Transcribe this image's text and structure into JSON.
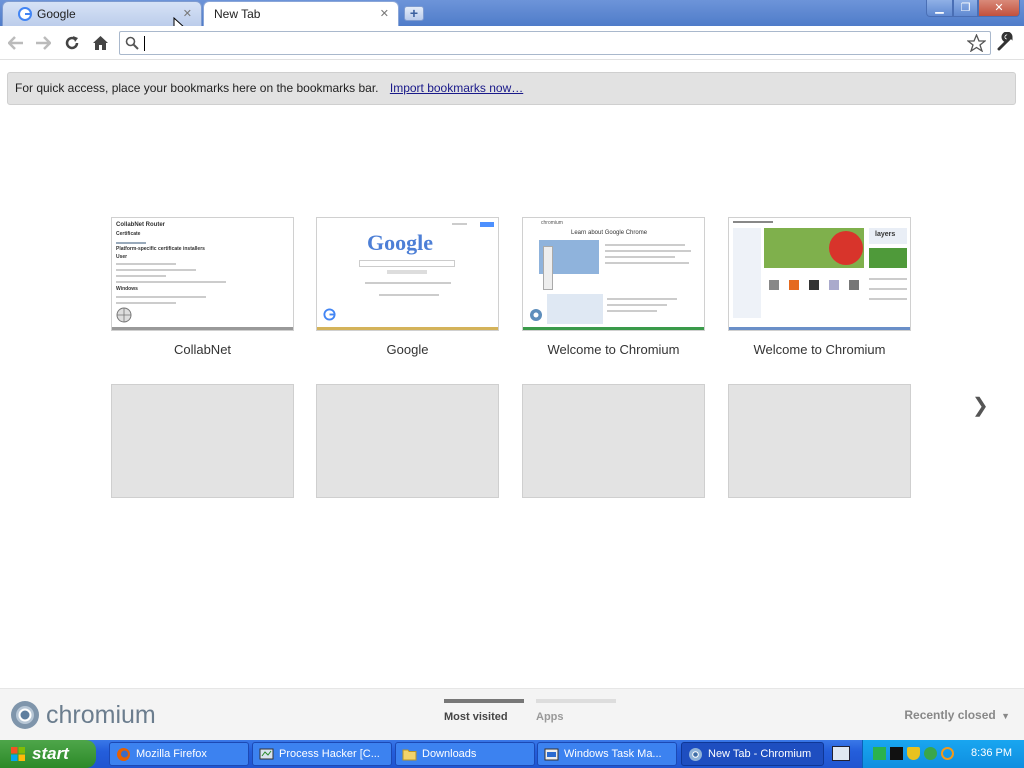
{
  "tabs": [
    {
      "label": "Google",
      "active": false
    },
    {
      "label": "New Tab",
      "active": true
    }
  ],
  "toolbar": {
    "omnibox_value": ""
  },
  "bookmark_prompt": {
    "text": "For quick access, place your bookmarks here on the bookmarks bar.",
    "link": "Import bookmarks now…"
  },
  "most_visited": [
    {
      "title": "CollabNet",
      "stripe": "#999999"
    },
    {
      "title": "Google",
      "stripe": "#d4b35a"
    },
    {
      "title": "Welcome to Chromium",
      "stripe": "#3a9a4a"
    },
    {
      "title": "Welcome to Chromium",
      "stripe": "#6a8fc8"
    }
  ],
  "thumb_text": {
    "collabnet_title": "CollabNet Router",
    "collabnet_l1": "Certificate",
    "collabnet_l2": "Platform-specific certificate installers",
    "collabnet_l3": "User",
    "collabnet_l4": "Windows",
    "google_logo": "Google",
    "chromium_heading": "Learn about Google Chrome",
    "chromium_word": "chromium",
    "layers": "layers"
  },
  "footer": {
    "brand": "chromium",
    "tab_most_visited": "Most visited",
    "tab_apps": "Apps",
    "recently_closed": "Recently closed"
  },
  "taskbar": {
    "start": "start",
    "tasks": [
      {
        "label": "Mozilla Firefox"
      },
      {
        "label": "Process Hacker [C..."
      },
      {
        "label": "Downloads"
      },
      {
        "label": "Windows Task Ma..."
      },
      {
        "label": "New Tab - Chromium"
      }
    ],
    "clock": "8:36 PM"
  },
  "colors": {
    "accent": "#4f7cc9",
    "taskbar": "#245edb",
    "start": "#2c8a28"
  }
}
